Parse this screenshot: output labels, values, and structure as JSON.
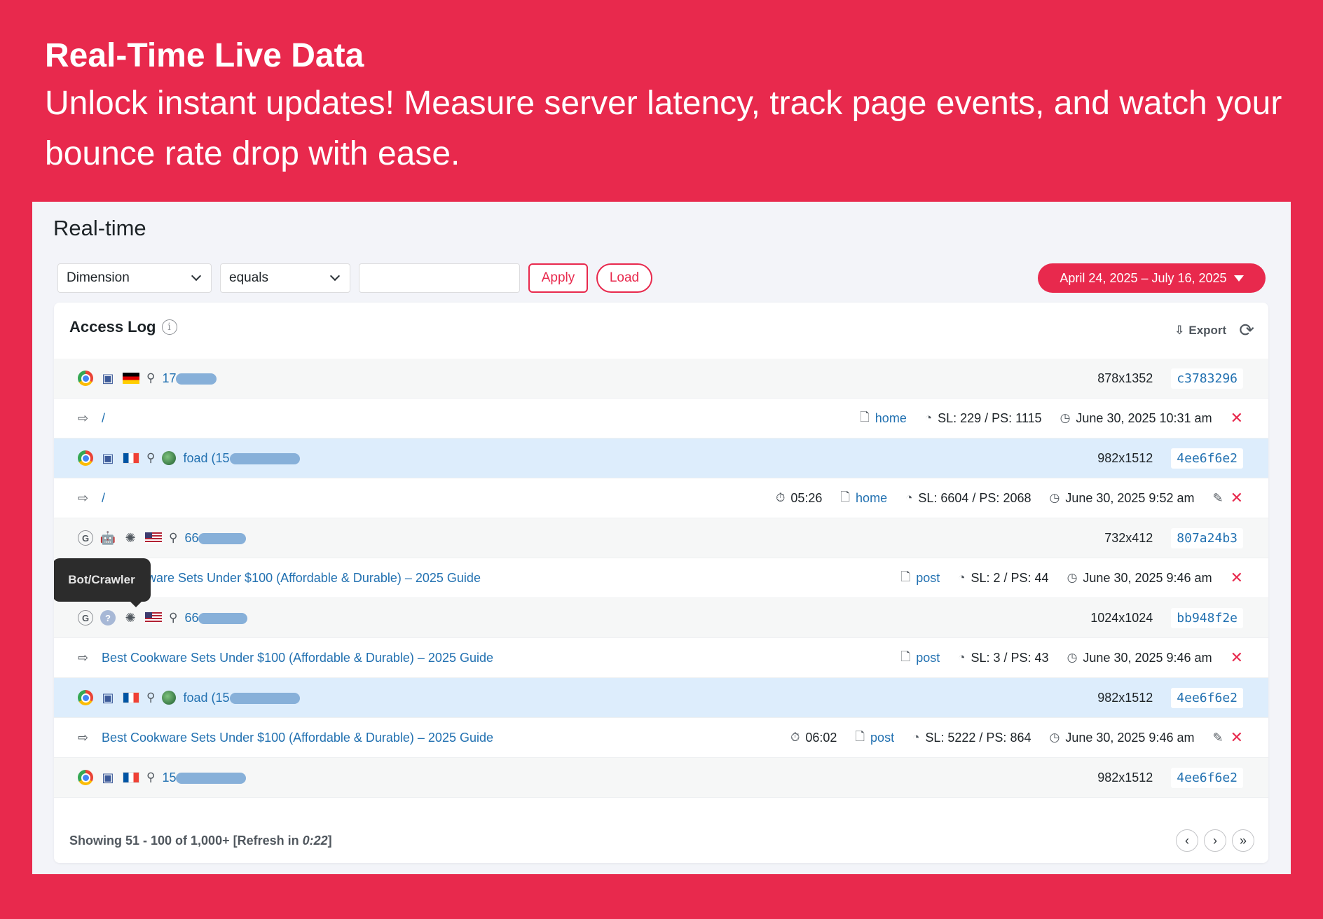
{
  "promo": {
    "headline": "Real-Time Live Data",
    "tagline": "Unlock instant updates! Measure server latency, track page events, and watch your bounce rate drop with ease."
  },
  "page": {
    "title": "Real-time"
  },
  "filters": {
    "dimension": "Dimension",
    "operator": "equals",
    "value": "",
    "apply_label": "Apply",
    "load_label": "Load"
  },
  "date_range": "April 24, 2025 – July 16, 2025",
  "card": {
    "title": "Access Log",
    "export_label": "Export"
  },
  "tooltip": "Bot/Crawler",
  "rows": [
    {
      "type": "visitor",
      "icons": [
        "chrome-icon",
        "mac-icon",
        "flag-de"
      ],
      "ip_prefix": "17",
      "resolution": "878x1352",
      "hash": "c3783296"
    },
    {
      "type": "page",
      "path": "/",
      "duration": "",
      "page_type": "home",
      "speed": "SL: 229 / PS: 1115",
      "time": "June 30, 2025 10:31 am",
      "edit": false
    },
    {
      "type": "visitor",
      "selected": true,
      "icons": [
        "chrome-icon",
        "mac-icon",
        "flag-fr"
      ],
      "user": "foad (15",
      "resolution": "982x1512",
      "hash": "4ee6f6e2"
    },
    {
      "type": "page",
      "path": "/",
      "duration": "05:26",
      "page_type": "home",
      "speed": "SL: 6604 / PS: 2068",
      "time": "June 30, 2025 9:52 am",
      "edit": true
    },
    {
      "type": "visitor",
      "icons": [
        "google-icon",
        "android-icon",
        "bot-icon",
        "flag-us"
      ],
      "ip_prefix": "66",
      "resolution": "732x412",
      "hash": "807a24b3"
    },
    {
      "type": "page",
      "path": "Best Cookware Sets Under $100 (Affordable & Durable) – 2025 Guide",
      "visible_path": "kware Sets Under $100 (Affordable & Durable) – 2025 Guide",
      "duration": "",
      "page_type": "post",
      "speed": "SL: 2 / PS: 44",
      "time": "June 30, 2025 9:46 am",
      "edit": false
    },
    {
      "type": "visitor",
      "icons": [
        "google-icon",
        "unknown-icon",
        "bot-icon",
        "flag-us"
      ],
      "ip_prefix": "66",
      "resolution": "1024x1024",
      "hash": "bb948f2e"
    },
    {
      "type": "page",
      "path": "Best Cookware Sets Under $100 (Affordable & Durable) – 2025 Guide",
      "duration": "",
      "page_type": "post",
      "speed": "SL: 3 / PS: 43",
      "time": "June 30, 2025 9:46 am",
      "edit": false
    },
    {
      "type": "visitor",
      "selected": true,
      "icons": [
        "chrome-icon",
        "mac-icon",
        "flag-fr"
      ],
      "user": "foad (15",
      "resolution": "982x1512",
      "hash": "4ee6f6e2"
    },
    {
      "type": "page",
      "path": "Best Cookware Sets Under $100 (Affordable & Durable) – 2025 Guide",
      "duration": "06:02",
      "page_type": "post",
      "speed": "SL: 5222 / PS: 864",
      "time": "June 30, 2025 9:46 am",
      "edit": true
    },
    {
      "type": "visitor",
      "icons": [
        "chrome-icon",
        "mac-icon",
        "flag-fr"
      ],
      "ip_prefix": "15",
      "resolution": "982x1512",
      "hash": "4ee6f6e2"
    }
  ],
  "footer": {
    "status_prefix": "Showing 51 - 100 of 1,000+ [Refresh in ",
    "countdown": "0:22",
    "status_suffix": "]"
  },
  "colors": {
    "accent": "#e8294d",
    "link": "#2271b1",
    "selected_row": "#ddedfc"
  }
}
